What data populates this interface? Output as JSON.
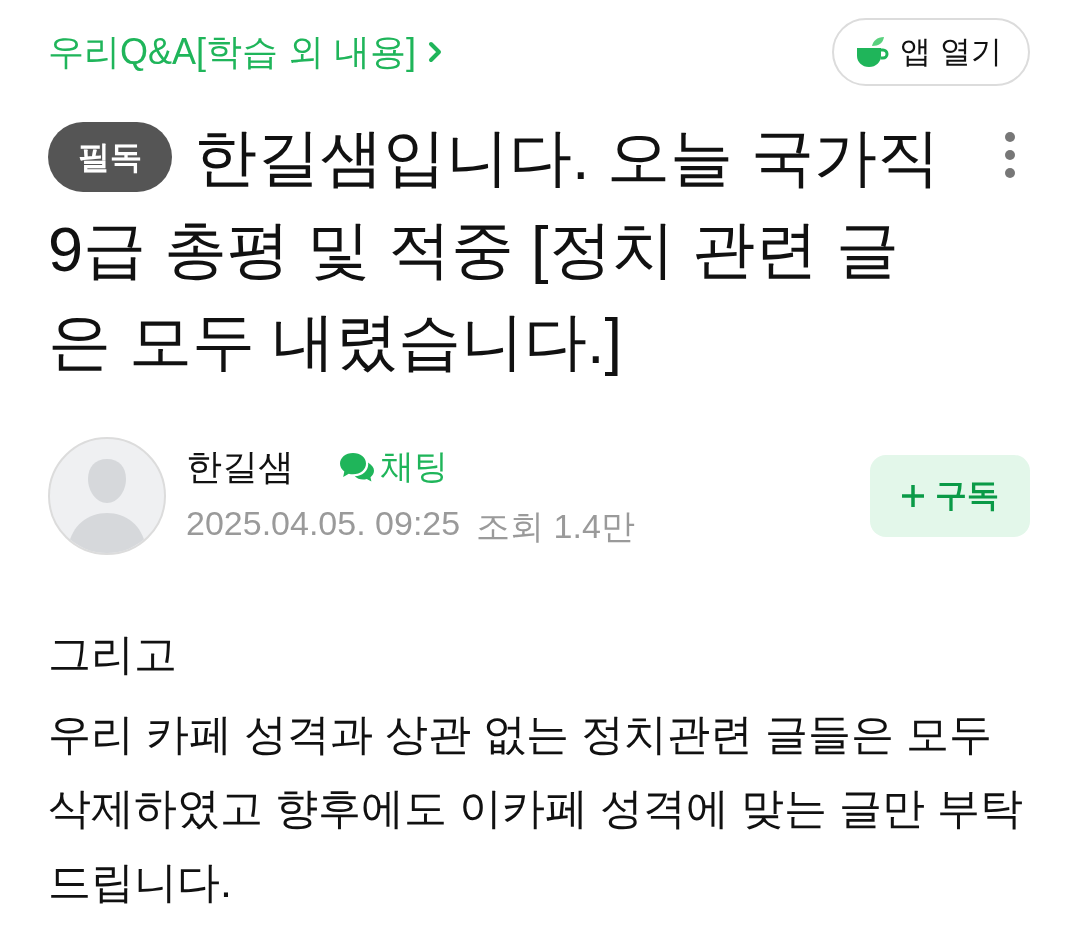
{
  "breadcrumb": {
    "label": "우리Q&A[학습 외 내용]"
  },
  "app_button": {
    "label": "앱 열기"
  },
  "post": {
    "badge": "필독",
    "title_lines": [
      "한길샘입니다. 오늘 국가직",
      "9급 총평 및 적중 [정치 관련 글",
      "은 모두 내렸습니다.]"
    ]
  },
  "author": {
    "name": "한길샘",
    "chat_label": "채팅",
    "date": "2025.04.05. 09:25",
    "views": "조회 1.4만",
    "subscribe_label": "구독"
  },
  "body": {
    "paragraphs": [
      "그리고",
      "우리 카페 성격과 상관 없는 정치관련 글들은 모두 삭제하였고 향후에도 이카페 성격에 맞는 글만 부탁드립니다."
    ]
  }
}
